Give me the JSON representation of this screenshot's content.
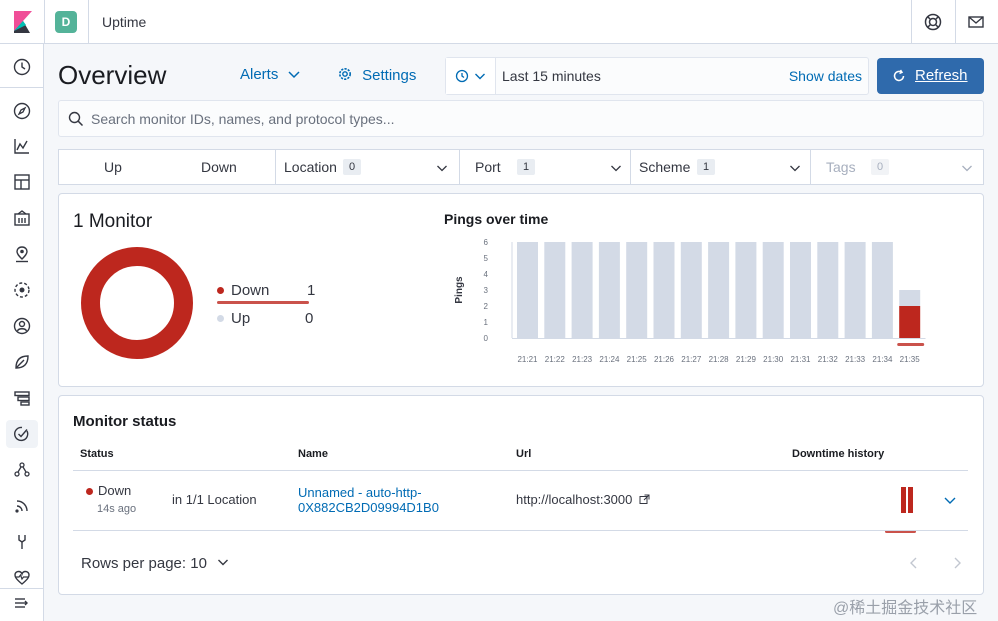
{
  "header": {
    "space_initial": "D",
    "app_title": "Uptime"
  },
  "page": {
    "title": "Overview",
    "alerts_label": "Alerts",
    "settings_label": "Settings",
    "time_range": "Last 15 minutes",
    "show_dates_label": "Show dates",
    "refresh_label": "Refresh"
  },
  "search": {
    "placeholder": "Search monitor IDs, names, and protocol types..."
  },
  "filters": {
    "up_label": "Up",
    "down_label": "Down",
    "location": {
      "label": "Location",
      "count": "0"
    },
    "port": {
      "label": "Port",
      "count": "1"
    },
    "scheme": {
      "label": "Scheme",
      "count": "1"
    },
    "tags": {
      "label": "Tags",
      "count": "0"
    }
  },
  "snapshot": {
    "title": "1 Monitor",
    "legend": [
      {
        "label": "Down",
        "value": "1",
        "color": "#bd271e"
      },
      {
        "label": "Up",
        "value": "0",
        "color": "#d3dae6"
      }
    ]
  },
  "chart_data": {
    "type": "bar",
    "title": "Pings over time",
    "ylabel": "Pings",
    "xlabel": "",
    "ylim": [
      0,
      6
    ],
    "yticks": [
      "0",
      "1",
      "2",
      "3",
      "4",
      "5",
      "6"
    ],
    "categories": [
      "21:21",
      "21:22",
      "21:23",
      "21:24",
      "21:25",
      "21:26",
      "21:27",
      "21:28",
      "21:29",
      "21:30",
      "21:31",
      "21:32",
      "21:33",
      "21:34",
      "21:35"
    ],
    "series": [
      {
        "name": "Down",
        "color": "#bd271e",
        "values": [
          0,
          0,
          0,
          0,
          0,
          0,
          0,
          0,
          0,
          0,
          0,
          0,
          0,
          0,
          2
        ]
      },
      {
        "name": "Up",
        "color": "#d3dae6",
        "values": [
          6,
          6,
          6,
          6,
          6,
          6,
          6,
          6,
          6,
          6,
          6,
          6,
          6,
          6,
          1
        ]
      }
    ]
  },
  "monitor_status": {
    "title": "Monitor status",
    "columns": [
      "Status",
      "Name",
      "Url",
      "Downtime history"
    ],
    "rows": [
      {
        "status": "Down",
        "age": "14s ago",
        "location": "in 1/1 Location",
        "name_line1": "Unnamed - auto-http-",
        "name_line2": "0X882CB2D09994D1B0",
        "url": "http://localhost:3000"
      }
    ],
    "rows_per_page": "Rows per page: 10"
  },
  "watermark": "@稀土掘金技术社区",
  "colors": {
    "accent": "#006bb4",
    "danger": "#bd271e",
    "refresh_button": "#2f6aac"
  }
}
